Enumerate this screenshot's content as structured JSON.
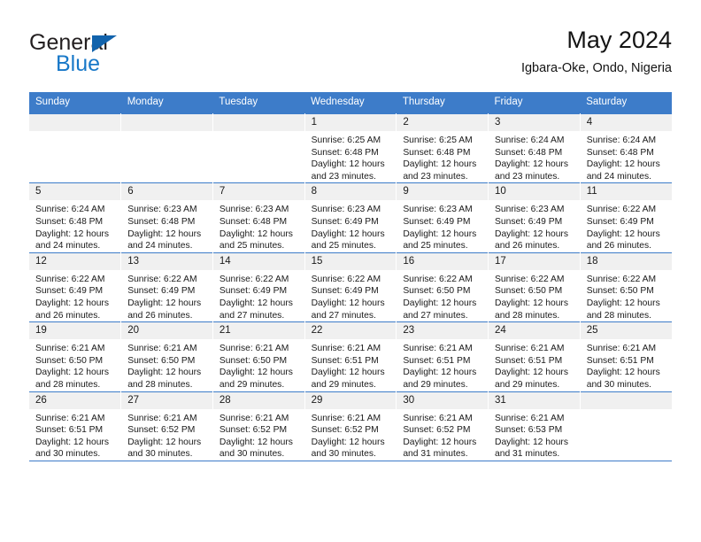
{
  "brand": {
    "name_top": "General",
    "name_bottom": "Blue",
    "triangle_color": "#1263ac",
    "blue_color": "#1878c8"
  },
  "header": {
    "title": "May 2024",
    "subtitle": "Igbara-Oke, Ondo, Nigeria"
  },
  "theme": {
    "header_bg": "#3d7cc9",
    "daynum_bg": "#f0f0f0",
    "grid_line": "#3d7cc9",
    "text": "#1a1a1a"
  },
  "weekdays": [
    "Sunday",
    "Monday",
    "Tuesday",
    "Wednesday",
    "Thursday",
    "Friday",
    "Saturday"
  ],
  "weeks": [
    [
      {
        "day": "",
        "empty": true,
        "sunrise": "",
        "sunset": "",
        "daylight_line1": "",
        "daylight_line2": ""
      },
      {
        "day": "",
        "empty": true,
        "sunrise": "",
        "sunset": "",
        "daylight_line1": "",
        "daylight_line2": ""
      },
      {
        "day": "",
        "empty": true,
        "sunrise": "",
        "sunset": "",
        "daylight_line1": "",
        "daylight_line2": ""
      },
      {
        "day": "1",
        "sunrise": "Sunrise: 6:25 AM",
        "sunset": "Sunset: 6:48 PM",
        "daylight_line1": "Daylight: 12 hours",
        "daylight_line2": "and 23 minutes."
      },
      {
        "day": "2",
        "sunrise": "Sunrise: 6:25 AM",
        "sunset": "Sunset: 6:48 PM",
        "daylight_line1": "Daylight: 12 hours",
        "daylight_line2": "and 23 minutes."
      },
      {
        "day": "3",
        "sunrise": "Sunrise: 6:24 AM",
        "sunset": "Sunset: 6:48 PM",
        "daylight_line1": "Daylight: 12 hours",
        "daylight_line2": "and 23 minutes."
      },
      {
        "day": "4",
        "sunrise": "Sunrise: 6:24 AM",
        "sunset": "Sunset: 6:48 PM",
        "daylight_line1": "Daylight: 12 hours",
        "daylight_line2": "and 24 minutes."
      }
    ],
    [
      {
        "day": "5",
        "sunrise": "Sunrise: 6:24 AM",
        "sunset": "Sunset: 6:48 PM",
        "daylight_line1": "Daylight: 12 hours",
        "daylight_line2": "and 24 minutes."
      },
      {
        "day": "6",
        "sunrise": "Sunrise: 6:23 AM",
        "sunset": "Sunset: 6:48 PM",
        "daylight_line1": "Daylight: 12 hours",
        "daylight_line2": "and 24 minutes."
      },
      {
        "day": "7",
        "sunrise": "Sunrise: 6:23 AM",
        "sunset": "Sunset: 6:48 PM",
        "daylight_line1": "Daylight: 12 hours",
        "daylight_line2": "and 25 minutes."
      },
      {
        "day": "8",
        "sunrise": "Sunrise: 6:23 AM",
        "sunset": "Sunset: 6:49 PM",
        "daylight_line1": "Daylight: 12 hours",
        "daylight_line2": "and 25 minutes."
      },
      {
        "day": "9",
        "sunrise": "Sunrise: 6:23 AM",
        "sunset": "Sunset: 6:49 PM",
        "daylight_line1": "Daylight: 12 hours",
        "daylight_line2": "and 25 minutes."
      },
      {
        "day": "10",
        "sunrise": "Sunrise: 6:23 AM",
        "sunset": "Sunset: 6:49 PM",
        "daylight_line1": "Daylight: 12 hours",
        "daylight_line2": "and 26 minutes."
      },
      {
        "day": "11",
        "sunrise": "Sunrise: 6:22 AM",
        "sunset": "Sunset: 6:49 PM",
        "daylight_line1": "Daylight: 12 hours",
        "daylight_line2": "and 26 minutes."
      }
    ],
    [
      {
        "day": "12",
        "sunrise": "Sunrise: 6:22 AM",
        "sunset": "Sunset: 6:49 PM",
        "daylight_line1": "Daylight: 12 hours",
        "daylight_line2": "and 26 minutes."
      },
      {
        "day": "13",
        "sunrise": "Sunrise: 6:22 AM",
        "sunset": "Sunset: 6:49 PM",
        "daylight_line1": "Daylight: 12 hours",
        "daylight_line2": "and 26 minutes."
      },
      {
        "day": "14",
        "sunrise": "Sunrise: 6:22 AM",
        "sunset": "Sunset: 6:49 PM",
        "daylight_line1": "Daylight: 12 hours",
        "daylight_line2": "and 27 minutes."
      },
      {
        "day": "15",
        "sunrise": "Sunrise: 6:22 AM",
        "sunset": "Sunset: 6:49 PM",
        "daylight_line1": "Daylight: 12 hours",
        "daylight_line2": "and 27 minutes."
      },
      {
        "day": "16",
        "sunrise": "Sunrise: 6:22 AM",
        "sunset": "Sunset: 6:50 PM",
        "daylight_line1": "Daylight: 12 hours",
        "daylight_line2": "and 27 minutes."
      },
      {
        "day": "17",
        "sunrise": "Sunrise: 6:22 AM",
        "sunset": "Sunset: 6:50 PM",
        "daylight_line1": "Daylight: 12 hours",
        "daylight_line2": "and 28 minutes."
      },
      {
        "day": "18",
        "sunrise": "Sunrise: 6:22 AM",
        "sunset": "Sunset: 6:50 PM",
        "daylight_line1": "Daylight: 12 hours",
        "daylight_line2": "and 28 minutes."
      }
    ],
    [
      {
        "day": "19",
        "sunrise": "Sunrise: 6:21 AM",
        "sunset": "Sunset: 6:50 PM",
        "daylight_line1": "Daylight: 12 hours",
        "daylight_line2": "and 28 minutes."
      },
      {
        "day": "20",
        "sunrise": "Sunrise: 6:21 AM",
        "sunset": "Sunset: 6:50 PM",
        "daylight_line1": "Daylight: 12 hours",
        "daylight_line2": "and 28 minutes."
      },
      {
        "day": "21",
        "sunrise": "Sunrise: 6:21 AM",
        "sunset": "Sunset: 6:50 PM",
        "daylight_line1": "Daylight: 12 hours",
        "daylight_line2": "and 29 minutes."
      },
      {
        "day": "22",
        "sunrise": "Sunrise: 6:21 AM",
        "sunset": "Sunset: 6:51 PM",
        "daylight_line1": "Daylight: 12 hours",
        "daylight_line2": "and 29 minutes."
      },
      {
        "day": "23",
        "sunrise": "Sunrise: 6:21 AM",
        "sunset": "Sunset: 6:51 PM",
        "daylight_line1": "Daylight: 12 hours",
        "daylight_line2": "and 29 minutes."
      },
      {
        "day": "24",
        "sunrise": "Sunrise: 6:21 AM",
        "sunset": "Sunset: 6:51 PM",
        "daylight_line1": "Daylight: 12 hours",
        "daylight_line2": "and 29 minutes."
      },
      {
        "day": "25",
        "sunrise": "Sunrise: 6:21 AM",
        "sunset": "Sunset: 6:51 PM",
        "daylight_line1": "Daylight: 12 hours",
        "daylight_line2": "and 30 minutes."
      }
    ],
    [
      {
        "day": "26",
        "sunrise": "Sunrise: 6:21 AM",
        "sunset": "Sunset: 6:51 PM",
        "daylight_line1": "Daylight: 12 hours",
        "daylight_line2": "and 30 minutes."
      },
      {
        "day": "27",
        "sunrise": "Sunrise: 6:21 AM",
        "sunset": "Sunset: 6:52 PM",
        "daylight_line1": "Daylight: 12 hours",
        "daylight_line2": "and 30 minutes."
      },
      {
        "day": "28",
        "sunrise": "Sunrise: 6:21 AM",
        "sunset": "Sunset: 6:52 PM",
        "daylight_line1": "Daylight: 12 hours",
        "daylight_line2": "and 30 minutes."
      },
      {
        "day": "29",
        "sunrise": "Sunrise: 6:21 AM",
        "sunset": "Sunset: 6:52 PM",
        "daylight_line1": "Daylight: 12 hours",
        "daylight_line2": "and 30 minutes."
      },
      {
        "day": "30",
        "sunrise": "Sunrise: 6:21 AM",
        "sunset": "Sunset: 6:52 PM",
        "daylight_line1": "Daylight: 12 hours",
        "daylight_line2": "and 31 minutes."
      },
      {
        "day": "31",
        "sunrise": "Sunrise: 6:21 AM",
        "sunset": "Sunset: 6:53 PM",
        "daylight_line1": "Daylight: 12 hours",
        "daylight_line2": "and 31 minutes."
      },
      {
        "day": "",
        "empty": true,
        "sunrise": "",
        "sunset": "",
        "daylight_line1": "",
        "daylight_line2": ""
      }
    ]
  ]
}
